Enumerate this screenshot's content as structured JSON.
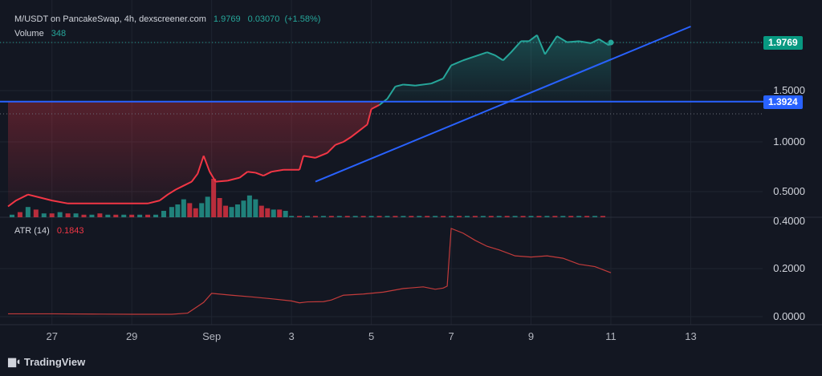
{
  "header": {
    "pair": "M/USDT on PancakeSwap, 4h, dexscreener.com",
    "price": "1.9769",
    "change": "0.03070",
    "change_pct": "(+1.58%)",
    "volume_label": "Volume",
    "volume_value": "348",
    "atr_label": "ATR (14)",
    "atr_value": "0.1843"
  },
  "price_tags": {
    "last": "1.9769",
    "horizontal_line": "1.3924"
  },
  "footer": {
    "logo_text": "TradingView"
  },
  "colors": {
    "up": "#26a69a",
    "down": "#f23645",
    "line": "#2962ff",
    "background": "#131722",
    "atr": "#c33b3b"
  },
  "chart_data": [
    {
      "type": "line",
      "name": "price",
      "x_ticks": [
        {
          "label": "27",
          "x": 27
        },
        {
          "label": "29",
          "x": 29
        },
        {
          "label": "Sep",
          "x": 31
        },
        {
          "label": "3",
          "x": 33
        },
        {
          "label": "5",
          "x": 35
        },
        {
          "label": "7",
          "x": 37
        },
        {
          "label": "9",
          "x": 39
        },
        {
          "label": "11",
          "x": 41
        },
        {
          "label": "13",
          "x": 43
        }
      ],
      "y_ticks": [
        "0.4000",
        "0.5000",
        "1.0000",
        "1.5000"
      ],
      "ylim": [
        0.4,
        2.08
      ],
      "xlim": [
        25.9,
        44.8
      ],
      "points": [
        [
          25.9,
          0.45
        ],
        [
          26.1,
          0.47
        ],
        [
          26.4,
          0.49
        ],
        [
          26.7,
          0.48
        ],
        [
          27.0,
          0.47
        ],
        [
          27.4,
          0.46
        ],
        [
          27.8,
          0.46
        ],
        [
          28.2,
          0.46
        ],
        [
          28.6,
          0.46
        ],
        [
          29.0,
          0.46
        ],
        [
          29.4,
          0.46
        ],
        [
          29.7,
          0.47
        ],
        [
          29.9,
          0.49
        ],
        [
          30.1,
          0.52
        ],
        [
          30.3,
          0.56
        ],
        [
          30.5,
          0.6
        ],
        [
          30.65,
          0.68
        ],
        [
          30.8,
          0.86
        ],
        [
          30.95,
          0.7
        ],
        [
          31.1,
          0.6
        ],
        [
          31.4,
          0.61
        ],
        [
          31.7,
          0.64
        ],
        [
          31.9,
          0.7
        ],
        [
          32.1,
          0.69
        ],
        [
          32.3,
          0.66
        ],
        [
          32.5,
          0.7
        ],
        [
          32.8,
          0.72
        ],
        [
          33.2,
          0.72
        ],
        [
          33.3,
          0.86
        ],
        [
          33.6,
          0.84
        ],
        [
          33.9,
          0.89
        ],
        [
          34.1,
          0.97
        ],
        [
          34.3,
          1.0
        ],
        [
          34.5,
          1.05
        ],
        [
          34.7,
          1.11
        ],
        [
          34.9,
          1.17
        ],
        [
          35.0,
          1.32
        ],
        [
          35.2,
          1.36
        ],
        [
          35.4,
          1.42
        ],
        [
          35.6,
          1.54
        ],
        [
          35.8,
          1.56
        ],
        [
          36.1,
          1.55
        ],
        [
          36.5,
          1.57
        ],
        [
          36.8,
          1.62
        ],
        [
          37.0,
          1.75
        ],
        [
          37.3,
          1.8
        ],
        [
          37.6,
          1.84
        ],
        [
          37.9,
          1.88
        ],
        [
          38.1,
          1.85
        ],
        [
          38.3,
          1.8
        ],
        [
          38.5,
          1.88
        ],
        [
          38.75,
          1.99
        ],
        [
          38.95,
          1.99
        ],
        [
          39.15,
          2.05
        ],
        [
          39.35,
          1.86
        ],
        [
          39.65,
          2.04
        ],
        [
          39.9,
          1.98
        ],
        [
          40.2,
          1.99
        ],
        [
          40.5,
          1.97
        ],
        [
          40.7,
          2.01
        ],
        [
          40.95,
          1.95
        ],
        [
          41.0,
          1.9769
        ]
      ],
      "trendline": {
        "from": [
          33.6,
          0.6
        ],
        "to": [
          43.0,
          2.1
        ]
      },
      "horizontal_line": 1.3924,
      "dotted_levels": [
        1.9769,
        1.3924
      ]
    },
    {
      "type": "bar",
      "name": "Volume",
      "bars": [
        {
          "x": 26.0,
          "v": 0.2,
          "up": true
        },
        {
          "x": 26.2,
          "v": 0.4,
          "up": false
        },
        {
          "x": 26.4,
          "v": 0.8,
          "up": true
        },
        {
          "x": 26.6,
          "v": 0.6,
          "up": false
        },
        {
          "x": 26.8,
          "v": 0.3,
          "up": true
        },
        {
          "x": 27.0,
          "v": 0.3,
          "up": false
        },
        {
          "x": 27.2,
          "v": 0.4,
          "up": true
        },
        {
          "x": 27.4,
          "v": 0.3,
          "up": false
        },
        {
          "x": 27.6,
          "v": 0.3,
          "up": true
        },
        {
          "x": 27.8,
          "v": 0.2,
          "up": false
        },
        {
          "x": 28.0,
          "v": 0.2,
          "up": true
        },
        {
          "x": 28.2,
          "v": 0.3,
          "up": false
        },
        {
          "x": 28.4,
          "v": 0.2,
          "up": true
        },
        {
          "x": 28.6,
          "v": 0.2,
          "up": false
        },
        {
          "x": 28.8,
          "v": 0.2,
          "up": true
        },
        {
          "x": 29.0,
          "v": 0.2,
          "up": false
        },
        {
          "x": 29.2,
          "v": 0.2,
          "up": true
        },
        {
          "x": 29.4,
          "v": 0.2,
          "up": false
        },
        {
          "x": 29.6,
          "v": 0.2,
          "up": true
        },
        {
          "x": 29.8,
          "v": 0.5,
          "up": true
        },
        {
          "x": 30.0,
          "v": 0.8,
          "up": true
        },
        {
          "x": 30.15,
          "v": 1.0,
          "up": true
        },
        {
          "x": 30.3,
          "v": 1.4,
          "up": true
        },
        {
          "x": 30.45,
          "v": 1.1,
          "up": false
        },
        {
          "x": 30.6,
          "v": 0.7,
          "up": false
        },
        {
          "x": 30.75,
          "v": 1.1,
          "up": true
        },
        {
          "x": 30.9,
          "v": 1.6,
          "up": true
        },
        {
          "x": 31.05,
          "v": 3.0,
          "up": false
        },
        {
          "x": 31.2,
          "v": 1.5,
          "up": false
        },
        {
          "x": 31.35,
          "v": 0.9,
          "up": false
        },
        {
          "x": 31.5,
          "v": 0.8,
          "up": true
        },
        {
          "x": 31.65,
          "v": 1.0,
          "up": true
        },
        {
          "x": 31.8,
          "v": 1.3,
          "up": true
        },
        {
          "x": 31.95,
          "v": 1.7,
          "up": true
        },
        {
          "x": 32.1,
          "v": 1.4,
          "up": true
        },
        {
          "x": 32.25,
          "v": 0.9,
          "up": false
        },
        {
          "x": 32.4,
          "v": 0.7,
          "up": false
        },
        {
          "x": 32.55,
          "v": 0.6,
          "up": true
        },
        {
          "x": 32.7,
          "v": 0.6,
          "up": false
        },
        {
          "x": 32.85,
          "v": 0.5,
          "up": true
        },
        {
          "x": 33.0,
          "v": 0.1,
          "up": true
        },
        {
          "x": 33.2,
          "v": 0.1,
          "up": false
        },
        {
          "x": 33.4,
          "v": 0.1,
          "up": true
        },
        {
          "x": 33.6,
          "v": 0.1,
          "up": false
        },
        {
          "x": 33.8,
          "v": 0.1,
          "up": true
        },
        {
          "x": 34.0,
          "v": 0.1,
          "up": false
        },
        {
          "x": 34.2,
          "v": 0.1,
          "up": true
        },
        {
          "x": 34.4,
          "v": 0.1,
          "up": false
        },
        {
          "x": 34.6,
          "v": 0.1,
          "up": true
        },
        {
          "x": 34.8,
          "v": 0.1,
          "up": false
        },
        {
          "x": 35.0,
          "v": 0.1,
          "up": true
        },
        {
          "x": 35.2,
          "v": 0.1,
          "up": false
        },
        {
          "x": 35.4,
          "v": 0.1,
          "up": true
        },
        {
          "x": 35.6,
          "v": 0.1,
          "up": false
        },
        {
          "x": 35.8,
          "v": 0.1,
          "up": true
        },
        {
          "x": 36.0,
          "v": 0.1,
          "up": false
        },
        {
          "x": 36.2,
          "v": 0.1,
          "up": true
        },
        {
          "x": 36.4,
          "v": 0.1,
          "up": false
        },
        {
          "x": 36.6,
          "v": 0.1,
          "up": true
        },
        {
          "x": 36.8,
          "v": 0.1,
          "up": false
        },
        {
          "x": 37.0,
          "v": 0.1,
          "up": true
        },
        {
          "x": 37.2,
          "v": 0.1,
          "up": false
        },
        {
          "x": 37.4,
          "v": 0.1,
          "up": true
        },
        {
          "x": 37.6,
          "v": 0.1,
          "up": false
        },
        {
          "x": 37.8,
          "v": 0.1,
          "up": true
        },
        {
          "x": 38.0,
          "v": 0.1,
          "up": false
        },
        {
          "x": 38.2,
          "v": 0.1,
          "up": true
        },
        {
          "x": 38.4,
          "v": 0.1,
          "up": false
        },
        {
          "x": 38.6,
          "v": 0.1,
          "up": true
        },
        {
          "x": 38.8,
          "v": 0.1,
          "up": false
        },
        {
          "x": 39.0,
          "v": 0.1,
          "up": true
        },
        {
          "x": 39.2,
          "v": 0.1,
          "up": false
        },
        {
          "x": 39.4,
          "v": 0.1,
          "up": true
        },
        {
          "x": 39.6,
          "v": 0.1,
          "up": false
        },
        {
          "x": 39.8,
          "v": 0.1,
          "up": true
        },
        {
          "x": 40.0,
          "v": 0.1,
          "up": false
        },
        {
          "x": 40.2,
          "v": 0.1,
          "up": true
        },
        {
          "x": 40.4,
          "v": 0.1,
          "up": false
        },
        {
          "x": 40.6,
          "v": 0.1,
          "up": true
        },
        {
          "x": 40.8,
          "v": 0.1,
          "up": false
        }
      ]
    },
    {
      "type": "line",
      "name": "ATR (14)",
      "y_ticks": [
        "0.4000",
        "0.2000",
        "0.0000"
      ],
      "ylim": [
        -0.025,
        0.4
      ],
      "points": [
        [
          25.9,
          0.012
        ],
        [
          27.0,
          0.012
        ],
        [
          28.0,
          0.011
        ],
        [
          29.0,
          0.01
        ],
        [
          30.0,
          0.01
        ],
        [
          30.4,
          0.015
        ],
        [
          30.8,
          0.06
        ],
        [
          31.0,
          0.098
        ],
        [
          31.5,
          0.09
        ],
        [
          32.0,
          0.083
        ],
        [
          32.5,
          0.075
        ],
        [
          33.0,
          0.066
        ],
        [
          33.2,
          0.058
        ],
        [
          33.4,
          0.062
        ],
        [
          33.8,
          0.063
        ],
        [
          34.0,
          0.07
        ],
        [
          34.3,
          0.09
        ],
        [
          34.8,
          0.095
        ],
        [
          35.3,
          0.103
        ],
        [
          35.8,
          0.118
        ],
        [
          36.3,
          0.125
        ],
        [
          36.6,
          0.115
        ],
        [
          36.8,
          0.12
        ],
        [
          36.9,
          0.128
        ],
        [
          37.0,
          0.37
        ],
        [
          37.3,
          0.35
        ],
        [
          37.6,
          0.32
        ],
        [
          37.9,
          0.295
        ],
        [
          38.2,
          0.28
        ],
        [
          38.6,
          0.255
        ],
        [
          39.0,
          0.25
        ],
        [
          39.4,
          0.255
        ],
        [
          39.8,
          0.245
        ],
        [
          40.2,
          0.22
        ],
        [
          40.6,
          0.21
        ],
        [
          41.0,
          0.1843
        ]
      ]
    }
  ]
}
